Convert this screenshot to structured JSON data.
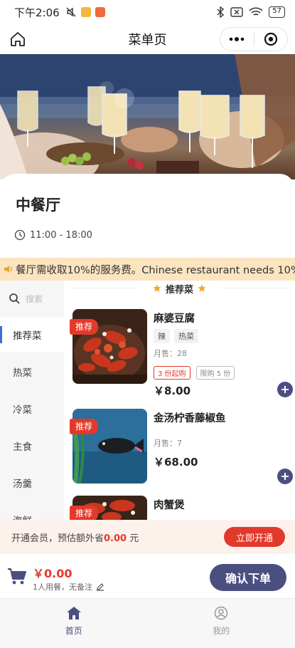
{
  "status_bar": {
    "time": "下午2:06",
    "battery": "57"
  },
  "nav": {
    "title": "菜单页"
  },
  "restaurant": {
    "name": "中餐厅",
    "hours": "11:00 - 18:00"
  },
  "notice": {
    "text": "餐厅需收取10%的服务费。Chinese restaurant needs 10%"
  },
  "search": {
    "placeholder": "搜索"
  },
  "categories": [
    {
      "label": "推荐菜"
    },
    {
      "label": "热菜"
    },
    {
      "label": "冷菜"
    },
    {
      "label": "主食"
    },
    {
      "label": "汤羹"
    },
    {
      "label": "海鲜"
    }
  ],
  "section": {
    "title": "推荐菜"
  },
  "dishes": [
    {
      "name": "麻婆豆腐",
      "badge": "推荐",
      "tags": [
        "辣",
        "热菜"
      ],
      "sales": "月售：28",
      "min_order": "3 份起购",
      "limit": "限购 5 份",
      "price": "￥8.00"
    },
    {
      "name": "金汤柠香藤椒鱼",
      "badge": "推荐",
      "sales": "月售：7",
      "price": "￥68.00"
    },
    {
      "name": "肉蟹煲",
      "badge": "推荐"
    }
  ],
  "member": {
    "prefix": "开通会员，预估额外省",
    "amount": "0.00",
    "suffix": " 元",
    "button": "立即开通"
  },
  "cart": {
    "total": "￥0.00",
    "note": "1人用餐，无备注",
    "confirm": "确认下单"
  },
  "tabs": [
    {
      "label": "首页"
    },
    {
      "label": "我的"
    }
  ],
  "colors": {
    "accent": "#4b4f80",
    "red": "#e3392b",
    "notice_bg": "#fbe4bf",
    "member_bg": "#fdf1ec"
  }
}
